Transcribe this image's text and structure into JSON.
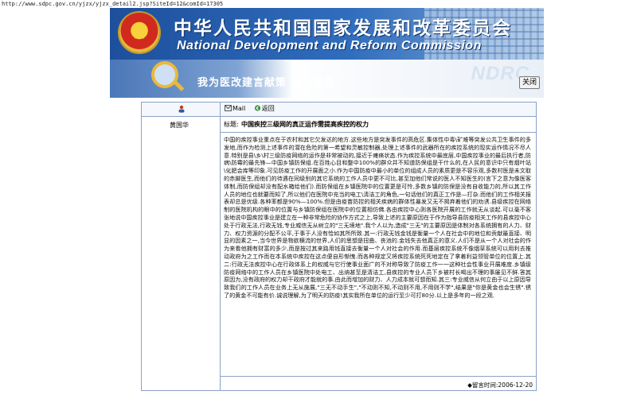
{
  "address_bar": {
    "url": "http://www.sdpc.gov.cn/yjzx/yjzx_detail2.jsp?SiteId=12&comId=17305"
  },
  "header": {
    "title_cn": "中华人民共和国国家发展和改革委员会",
    "title_en": "National Development and Reform Commission"
  },
  "subheader": {
    "title": "我为医改建言献策 意见浏览",
    "close_label": "关闭"
  },
  "toolbar": {
    "mail_label": "Mail",
    "back_label": "返回"
  },
  "post": {
    "author": "黄国华",
    "subject_label": "标题:",
    "subject": "中国疾控三级网的真正运作需提高疾控的权力",
    "body": "中国的疾控事业重点在于农村和其它欠发达的地方.这些地方是突发事件的高危区.集体性中毒\\矿难等突发公共卫生事件的多发地,而作为检测上述事件的潜在危险的第一希望和灵敏控制器,处理上述事件的武器所在的疾控系统的现实运作情况不尽人意.特别是县\\乡\\村三级防疫网络的运作是非常被动的,接近于瘫痪状态.作为疾控系统中最底层,中国疾控事业的最后执行者,防病\\防霉的最先锋—中国乡镇防保组.在百姓心目和整中100%的群众并不知道防保组是干什么的,在人民的意识中只有烟叶站\\化肥会库等印象.可见防疫工作的开展面之小.作为中国防疫中最小的单位的组成人员的素质更是不容乐观,多数村医是未文取的赤脚医生,而他们的待遇在同级别的其它系统的工作人员中更不可比,甚至加他们常说的医人不知医生的(言下之意为像医客体制,而防保组却没有配水箱给他们).而防保组在乡镇医院中的位置更是可怜,多数乡镇的防保是没有自收能力的,所以其工作人员的地位也就要而知了,所以他们在医院中充当的电工\\清洁工的角色,一句话他们的真正工作是—打杂.而他们的工作相关报表却总是优级.各种率都是90%—100%.但是由疫苗防控的相关疾病的群体性暴发又无不揭弃着他们的劝诱.县级疾控在网络制的医院机构的眼中的位置与乡镇防保组在医院中的位置相仿佛.各由疾控中心则各医院开展的工作就无从谈起.可以毫不客张地说中国疾控事业是建立在一种非常危险的协作方式之上,导致上述的主要原因在于作为指导县防疫相关工作的县疾控中心处于行政无法,行政无钱,专业威信无从树立的\"三无境地\".我个人以为,造成\"三无\"的主要原因是体制对各系统拥有的人力、财力、权力资源的分配不公平,于事于人没有恰如其所所致.其一:行政无钱金钱是衡量一个人在社会中的地位和贡献最直接、明显的因素之一,当今世界是物欲横流的世界,人们的思想是扭曲、丧池的.金钱失去他真正的意义.人们不是从一个人对社会的作为来看他拥有财富的多少,而是按过其来路用钱直接去衡量一个人对社会的作用.而基层疾控系统不像烟草系统可以用利去推动政府为之工作而在本系统中疾控在这点便自形惭愧.而各种规定又将疾控系统死死地定在了拿着利益领管单位的位置上.其二:行政无法疾控中心在行政体系上的权威与它行使事业面广的不对称导致了防疫工作一一这种社会性事业开展难度.乡镇级防疫网络中的工作人员在乡镇医院中处电工、出纳甚至是清洁工,县疾控的专业人员下乡被村长喝出不理的事屡见不鲜.答其原因为,没有政府的权力却干政府才能就的事.由此而增加的财力、人力成本就可想而知.其三:专业威信从何立由于以上原因导致我们的工作人员在业务上无从施展,\"三无不动手生\",\"不动则不知,不动则不用,不用则不学\",结果是\"你是黄金也会生锈\".锈了的黄金不可能有价.诚说理解,为了明天的防疫!其实我所在单位的运行至少可打80分.以上是多年的一段之观.",
    "footer": "◆留言时间:2006-12-20"
  }
}
